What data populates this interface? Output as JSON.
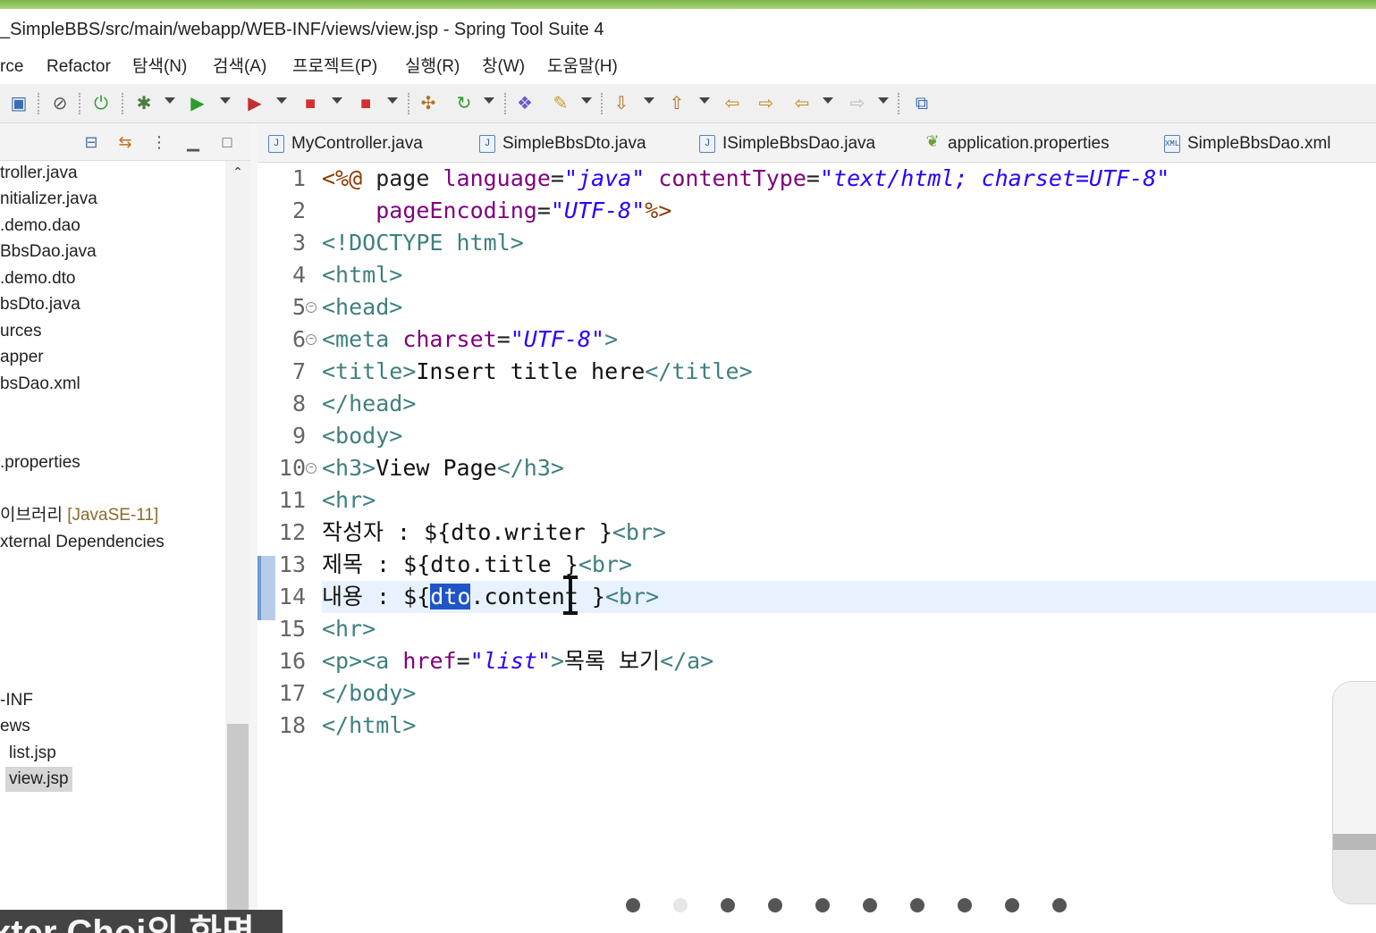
{
  "window": {
    "title": "_SimpleBBS/src/main/webapp/WEB-INF/views/view.jsp - Spring Tool Suite 4"
  },
  "menu": [
    "rce",
    "Refactor",
    "탐색(N)",
    "검색(A)",
    "프로젝트(P)",
    "실행(R)",
    "창(W)",
    "도움말(H)"
  ],
  "toolbar_icons": [
    "terminal-icon",
    "filter-icon",
    "spring-boot-icon",
    "debug-icon",
    "run-icon",
    "run-external-icon",
    "stop-icon",
    "stop-external-icon",
    "build-icon",
    "refresh-icon",
    "open-folder-icon",
    "wand-icon",
    "next-annotation-icon",
    "previous-annotation-icon",
    "last-edit-left-icon",
    "last-edit-right-icon",
    "back-icon",
    "forward-icon",
    "open-perspective-icon"
  ],
  "explorer": {
    "items": [
      {
        "label": "troller.java"
      },
      {
        "label": "nitializer.java"
      },
      {
        "label": ".demo.dao"
      },
      {
        "label": "BbsDao.java"
      },
      {
        "label": ".demo.dto"
      },
      {
        "label": "bsDto.java"
      },
      {
        "label": "urces"
      },
      {
        "label": "apper"
      },
      {
        "label": "bsDao.xml"
      },
      {
        "label": ".properties"
      },
      {
        "label": "이브러리",
        "hint": "[JavaSE-11]"
      },
      {
        "label": "xternal Dependencies"
      },
      {
        "label": "-INF"
      },
      {
        "label": "ews"
      },
      {
        "label": "list.jsp"
      },
      {
        "label": "view.jsp",
        "selected": true
      }
    ]
  },
  "tabs": [
    {
      "label": "MyController.java",
      "icon": "java-file-icon"
    },
    {
      "label": "SimpleBbsDto.java",
      "icon": "java-file-icon"
    },
    {
      "label": "ISimpleBbsDao.java",
      "icon": "java-file-icon"
    },
    {
      "label": "application.properties",
      "icon": "spring-leaf-icon"
    },
    {
      "label": "SimpleBbsDao.xml",
      "icon": "xml-file-icon"
    }
  ],
  "editor": {
    "current_line": 14,
    "selection": "dto",
    "lines": [
      {
        "n": "1",
        "text": "<%@ page language=\"java\" contentType=\"text/html; charset=UTF-8\""
      },
      {
        "n": "2",
        "text": "    pageEncoding=\"UTF-8\"%>"
      },
      {
        "n": "3",
        "text": "<!DOCTYPE html>"
      },
      {
        "n": "4",
        "text": "<html>"
      },
      {
        "n": "5",
        "text": "<head>"
      },
      {
        "n": "6",
        "text": "<meta charset=\"UTF-8\">"
      },
      {
        "n": "7",
        "text": "<title>Insert title here</title>"
      },
      {
        "n": "8",
        "text": "</head>"
      },
      {
        "n": "9",
        "text": "<body>"
      },
      {
        "n": "10",
        "text": "<h3>View Page</h3>"
      },
      {
        "n": "11",
        "text": "<hr>"
      },
      {
        "n": "12",
        "text": "작성자 : ${dto.writer }<br>"
      },
      {
        "n": "13",
        "text": "제목 : ${dto.title }<br>"
      },
      {
        "n": "14",
        "text": "내용 : ${dto.content }<br>"
      },
      {
        "n": "15",
        "text": "<hr>"
      },
      {
        "n": "16",
        "text": "<p><a href=\"list\">목록 보기</a>"
      },
      {
        "n": "17",
        "text": "</body>"
      },
      {
        "n": "18",
        "text": "</html>"
      }
    ]
  },
  "carousel": {
    "count": 10,
    "active": 2
  },
  "caption": {
    "text": "xter Choi의 화면"
  }
}
